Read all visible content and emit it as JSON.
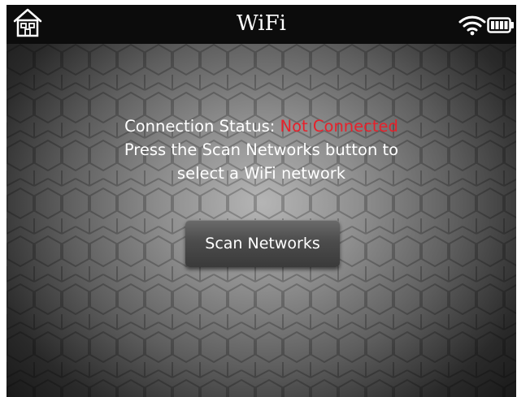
{
  "header": {
    "title": "WiFi",
    "home_icon": "home-icon",
    "wifi_icon": "wifi-signal-icon",
    "battery_icon": "battery-full-icon"
  },
  "main": {
    "status_label": "Connection Status:",
    "status_value": "Not Connected",
    "instruction_line1": "Press the Scan Networks button to",
    "instruction_line2": "select a WiFi network",
    "scan_button_label": "Scan Networks"
  },
  "colors": {
    "status_error": "#e8202a",
    "topbar": "#0c0c0c",
    "text": "#ffffff"
  }
}
